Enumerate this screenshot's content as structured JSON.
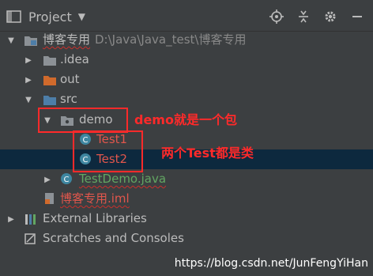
{
  "header": {
    "title": "Project",
    "icons": [
      "project-panel-icon",
      "caret-down-icon",
      "locate-icon",
      "collapse-all-icon",
      "gear-icon",
      "hide-icon"
    ]
  },
  "tree": {
    "root": {
      "name": "博客专用",
      "path": "D:\\Java\\Java_test\\博客专用"
    },
    "idea": ".idea",
    "out": "out",
    "src": "src",
    "demo": "demo",
    "test1": "Test1",
    "test2": "Test2",
    "testdemo": "TestDemo.java",
    "iml": "博客专用.iml",
    "external": "External Libraries",
    "scratches": "Scratches and Consoles"
  },
  "annotations": {
    "demo_note": "demo就是一个包",
    "test_note": "两个Test都是类"
  },
  "watermark": "https://blog.csdn.net/JunFengYiHan",
  "colors": {
    "background": "#3c3f41",
    "selected_row": "#0d293e",
    "red_text": "#e0564c",
    "green_text": "#62a662",
    "annotation_red": "#ff2a2a",
    "class_icon": "#3e86a0",
    "folder_gray": "#8c9196",
    "folder_orange": "#d06a2c",
    "folder_blue": "#4d7ea8"
  }
}
